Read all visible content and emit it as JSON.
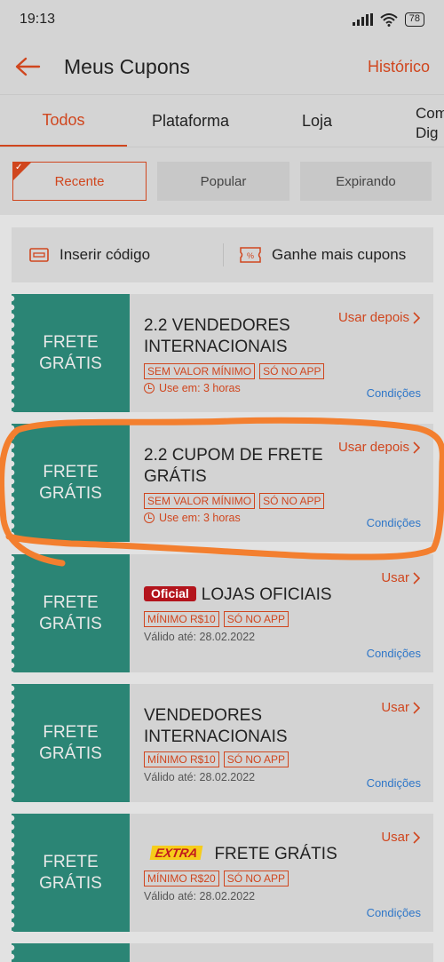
{
  "status": {
    "time": "19:13",
    "battery": "78"
  },
  "header": {
    "title": "Meus Cupons",
    "history": "Histórico"
  },
  "tabs": [
    {
      "label": "Todos"
    },
    {
      "label": "Plataforma"
    },
    {
      "label": "Loja"
    }
  ],
  "tab_more": {
    "line1": "Com",
    "line2": "Dig"
  },
  "filters": {
    "recent": "Recente",
    "popular": "Popular",
    "expiring": "Expirando"
  },
  "code_bar": {
    "insert": "Inserir código",
    "earn_more": "Ganhe mais cupons"
  },
  "coupons": [
    {
      "badge_line1": "FRETE",
      "badge_line2": "GRÁTIS",
      "title": "2.2 VENDEDORES INTERNACIONAIS",
      "tag1": "SEM VALOR MÍNIMO",
      "tag2": "SÓ NO APP",
      "meta": "Use em: 3 horas",
      "action": "Usar depois",
      "conditions": "Condições"
    },
    {
      "badge_line1": "FRETE",
      "badge_line2": "GRÁTIS",
      "title": "2.2 CUPOM DE FRETE GRÁTIS",
      "tag1": "SEM VALOR MÍNIMO",
      "tag2": "SÓ NO APP",
      "meta": "Use em: 3 horas",
      "action": "Usar depois",
      "conditions": "Condições"
    },
    {
      "badge_line1": "FRETE",
      "badge_line2": "GRÁTIS",
      "brand": "Oficial",
      "title": "LOJAS OFICIAIS",
      "tag1": "MÍNIMO R$10",
      "tag2": "SÓ NO APP",
      "meta": "Válido até: 28.02.2022",
      "action": "Usar",
      "conditions": "Condições"
    },
    {
      "badge_line1": "FRETE",
      "badge_line2": "GRÁTIS",
      "title": "VENDEDORES INTERNACIONAIS",
      "tag1": "MÍNIMO R$10",
      "tag2": "SÓ NO APP",
      "meta": "Válido até: 28.02.2022",
      "action": "Usar",
      "conditions": "Condições"
    },
    {
      "badge_line1": "FRETE",
      "badge_line2": "GRÁTIS",
      "brand": "EXTRA",
      "title": "FRETE GRÁTIS",
      "tag1": "MÍNIMO R$20",
      "tag2": "SÓ NO APP",
      "meta": "Válido até: 28.02.2022",
      "action": "Usar",
      "conditions": "Condições"
    }
  ],
  "colors": {
    "accent": "#d0461e",
    "coupon_green": "#2b8575",
    "link_blue": "#2e76c8",
    "annotation_orange": "#f37f2f"
  }
}
